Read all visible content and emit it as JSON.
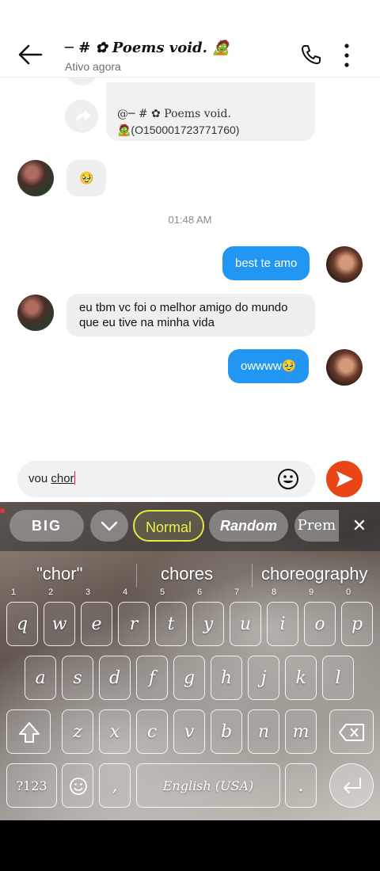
{
  "header": {
    "title": "─ # ✿ Poems void. 🧟",
    "subtitle": "Ativo agora"
  },
  "chat": {
    "share_card": {
      "line1": "@─ # ✿ Poems void.",
      "line2": "🧟(O150001723771760)"
    },
    "messages": [
      {
        "side": "in",
        "text": "🥹"
      },
      {
        "side": "out",
        "text": "best te amo"
      },
      {
        "side": "in",
        "text": "eu tbm vc foi o melhor amigo do mundo que eu tive na minha vida"
      },
      {
        "side": "out",
        "text": "owwww🥹"
      }
    ],
    "timestamp": "01:48 AM"
  },
  "composer": {
    "text_before": "vou ",
    "text_underlined": "chor"
  },
  "keyboard": {
    "toolbar": {
      "big": "BIG",
      "normal": "Normal",
      "random": "Random",
      "premium": "Prem",
      "close": "✕"
    },
    "suggestions": [
      "\"chor\"",
      "chores",
      "choreography"
    ],
    "row1": [
      {
        "k": "q",
        "h": "1"
      },
      {
        "k": "w",
        "h": "2"
      },
      {
        "k": "e",
        "h": "3"
      },
      {
        "k": "r",
        "h": "4"
      },
      {
        "k": "t",
        "h": "5"
      },
      {
        "k": "y",
        "h": "6"
      },
      {
        "k": "u",
        "h": "7"
      },
      {
        "k": "i",
        "h": "8"
      },
      {
        "k": "o",
        "h": "9"
      },
      {
        "k": "p",
        "h": "0"
      }
    ],
    "row2": [
      "a",
      "s",
      "d",
      "f",
      "g",
      "h",
      "j",
      "k",
      "l"
    ],
    "row3": [
      "z",
      "x",
      "c",
      "v",
      "b",
      "n",
      "m"
    ],
    "sym": "?123",
    "space": "English (USA)",
    "comma": ",",
    "period": "."
  }
}
